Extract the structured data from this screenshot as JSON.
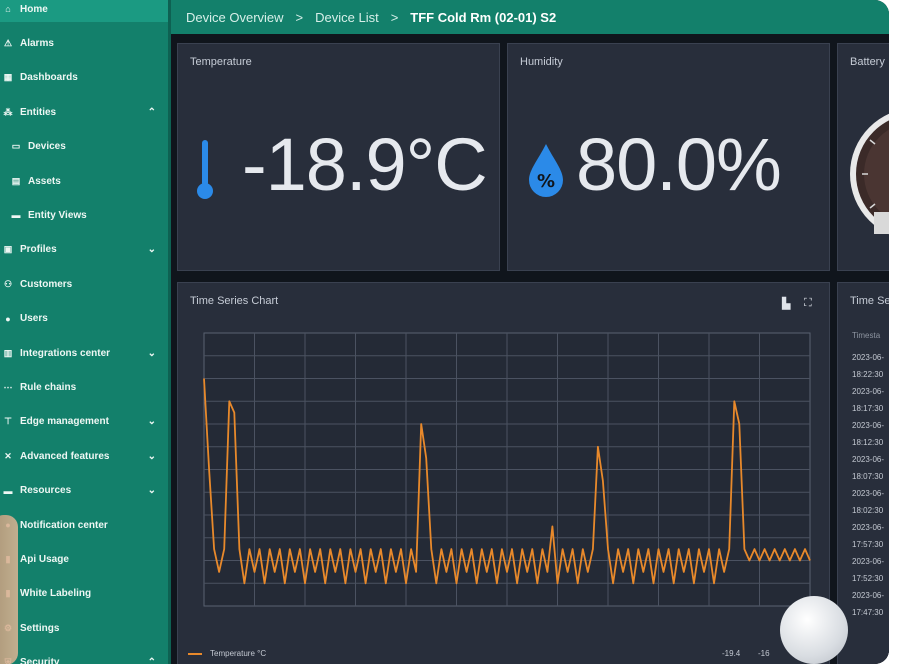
{
  "sidebar": {
    "items": [
      {
        "label": "Home",
        "icon": "home-icon",
        "glyph": "⌂",
        "sub": false,
        "active": true,
        "chevron": ""
      },
      {
        "label": "Alarms",
        "icon": "alarm-icon",
        "glyph": "⚠",
        "sub": false,
        "active": false,
        "chevron": ""
      },
      {
        "label": "Dashboards",
        "icon": "dashboard-icon",
        "glyph": "▦",
        "sub": false,
        "active": false,
        "chevron": ""
      },
      {
        "label": "Entities",
        "icon": "entities-icon",
        "glyph": "⁂",
        "sub": false,
        "active": false,
        "chevron": "⌃"
      },
      {
        "label": "Devices",
        "icon": "devices-icon",
        "glyph": "▭",
        "sub": true,
        "active": false,
        "chevron": ""
      },
      {
        "label": "Assets",
        "icon": "assets-icon",
        "glyph": "▤",
        "sub": true,
        "active": false,
        "chevron": ""
      },
      {
        "label": "Entity Views",
        "icon": "entity-views-icon",
        "glyph": "▬",
        "sub": true,
        "active": false,
        "chevron": ""
      },
      {
        "label": "Profiles",
        "icon": "profiles-icon",
        "glyph": "▣",
        "sub": false,
        "active": false,
        "chevron": "⌄"
      },
      {
        "label": "Customers",
        "icon": "customers-icon",
        "glyph": "⚇",
        "sub": false,
        "active": false,
        "chevron": ""
      },
      {
        "label": "Users",
        "icon": "users-icon",
        "glyph": "●",
        "sub": false,
        "active": false,
        "chevron": ""
      },
      {
        "label": "Integrations center",
        "icon": "integrations-icon",
        "glyph": "▥",
        "sub": false,
        "active": false,
        "chevron": "⌄"
      },
      {
        "label": "Rule chains",
        "icon": "rule-chains-icon",
        "glyph": "⋯",
        "sub": false,
        "active": false,
        "chevron": ""
      },
      {
        "label": "Edge management",
        "icon": "edge-icon",
        "glyph": "⊤",
        "sub": false,
        "active": false,
        "chevron": "⌄"
      },
      {
        "label": "Advanced features",
        "icon": "advanced-features-icon",
        "glyph": "✕",
        "sub": false,
        "active": false,
        "chevron": "⌄"
      },
      {
        "label": "Resources",
        "icon": "resources-icon",
        "glyph": "▬",
        "sub": false,
        "active": false,
        "chevron": "⌄"
      },
      {
        "label": "Notification center",
        "icon": "notification-icon",
        "glyph": "●",
        "sub": false,
        "active": false,
        "chevron": ""
      },
      {
        "label": "Api Usage",
        "icon": "api-usage-icon",
        "glyph": "▮",
        "sub": false,
        "active": false,
        "chevron": ""
      },
      {
        "label": "White Labeling",
        "icon": "white-labeling-icon",
        "glyph": "▮",
        "sub": false,
        "active": false,
        "chevron": ""
      },
      {
        "label": "Settings",
        "icon": "settings-icon",
        "glyph": "⚙",
        "sub": false,
        "active": false,
        "chevron": ""
      },
      {
        "label": "Security",
        "icon": "security-icon",
        "glyph": "⛨",
        "sub": false,
        "active": false,
        "chevron": "⌃"
      }
    ]
  },
  "breadcrumb": {
    "items": [
      "Device Overview",
      "Device List",
      "TFF Cold Rm (02-01) S2"
    ],
    "separator": ">"
  },
  "cards": {
    "temperature": {
      "title": "Temperature",
      "value": "-18.9°C",
      "icon_color": "#2b8ae8"
    },
    "humidity": {
      "title": "Humidity",
      "value": "80.0%",
      "icon_color": "#2b8ae8"
    },
    "battery": {
      "title": "Battery"
    },
    "time_series_chart": {
      "title": "Time Series Chart",
      "legend_label": "Temperature °C",
      "legend_value_1": "-19.4",
      "legend_value_2": "-16"
    },
    "time_series_table": {
      "title": "Time Se",
      "header": "Timesta",
      "rows": [
        "2023-06-",
        "18:22:30",
        "2023-06-",
        "18:17:30",
        "2023-06-",
        "18:12:30",
        "2023-06-",
        "18:07:30",
        "2023-06-",
        "18:02:30",
        "2023-06-",
        "17:57:30",
        "2023-06-",
        "17:52:30",
        "2023-06-",
        "17:47:30"
      ]
    }
  },
  "colors": {
    "brand": "#13806b",
    "series": "#e8892b",
    "card_bg": "#282e3b"
  },
  "chart_data": {
    "type": "line",
    "title": "Time Series Chart",
    "series": [
      {
        "name": "Temperature °C",
        "x": [
          0,
          0.5,
          1,
          1.5,
          2,
          2.5,
          3,
          3.5,
          4,
          4.5,
          5,
          5.5,
          6,
          6.5,
          7,
          7.5,
          8,
          8.5,
          9,
          9.5,
          10,
          10.5,
          11,
          11.5,
          12,
          12.5,
          13,
          13.5,
          14,
          14.5,
          15,
          15.5,
          16,
          16.5,
          17,
          17.5,
          18,
          18.5,
          19,
          19.5,
          20,
          20.5,
          21,
          21.5,
          22,
          22.5,
          23,
          23.5,
          24,
          24.5,
          25,
          25.5,
          26,
          26.5,
          27,
          27.5,
          28,
          28.5,
          29,
          29.5,
          30,
          30.5,
          31,
          31.5,
          32,
          32.5,
          33,
          33.5,
          34,
          34.5,
          35,
          35.5,
          36,
          36.5,
          37,
          37.5,
          38,
          38.5,
          39,
          39.5,
          40,
          40.5,
          41,
          41.5,
          42,
          42.5,
          43,
          43.5,
          44,
          44.5,
          45,
          45.5,
          46,
          46.5,
          47,
          47.5,
          48,
          48.5,
          49,
          49.5,
          50,
          50.5,
          51,
          51.5,
          52,
          52.5,
          53,
          53.5,
          54,
          54.5,
          55,
          55.5,
          56,
          56.5,
          57,
          57.5,
          58,
          58.5,
          59,
          59.5,
          60
        ],
        "values": [
          -4,
          -12,
          -19,
          -21,
          -19,
          -6,
          -7,
          -19,
          -22,
          -19,
          -21,
          -19,
          -22,
          -19,
          -21,
          -19,
          -22,
          -19,
          -21,
          -19,
          -22,
          -19,
          -21,
          -19,
          -22,
          -19,
          -21,
          -19,
          -22,
          -19,
          -21,
          -19,
          -22,
          -19,
          -21,
          -19,
          -22,
          -19,
          -21,
          -19,
          -22,
          -19,
          -21,
          -8,
          -11,
          -19,
          -22,
          -19,
          -21,
          -19,
          -22,
          -19,
          -21,
          -19,
          -22,
          -19,
          -21,
          -19,
          -22,
          -19,
          -21,
          -19,
          -22,
          -19,
          -21,
          -19,
          -22,
          -19,
          -21,
          -17,
          -22,
          -19,
          -21,
          -19,
          -22,
          -19,
          -21,
          -19,
          -10,
          -13,
          -19,
          -22,
          -19,
          -21,
          -19,
          -22,
          -19,
          -21,
          -19,
          -22,
          -19,
          -21,
          -19,
          -22,
          -19,
          -21,
          -19,
          -22,
          -19,
          -21,
          -19,
          -22,
          -19,
          -21,
          -19,
          -6,
          -8,
          -19,
          -20,
          -19,
          -20,
          -19,
          -20,
          -19,
          -20,
          -19,
          -20,
          -19,
          -20,
          -19,
          -20
        ]
      }
    ],
    "legend": "bottom-left",
    "grid": true
  }
}
